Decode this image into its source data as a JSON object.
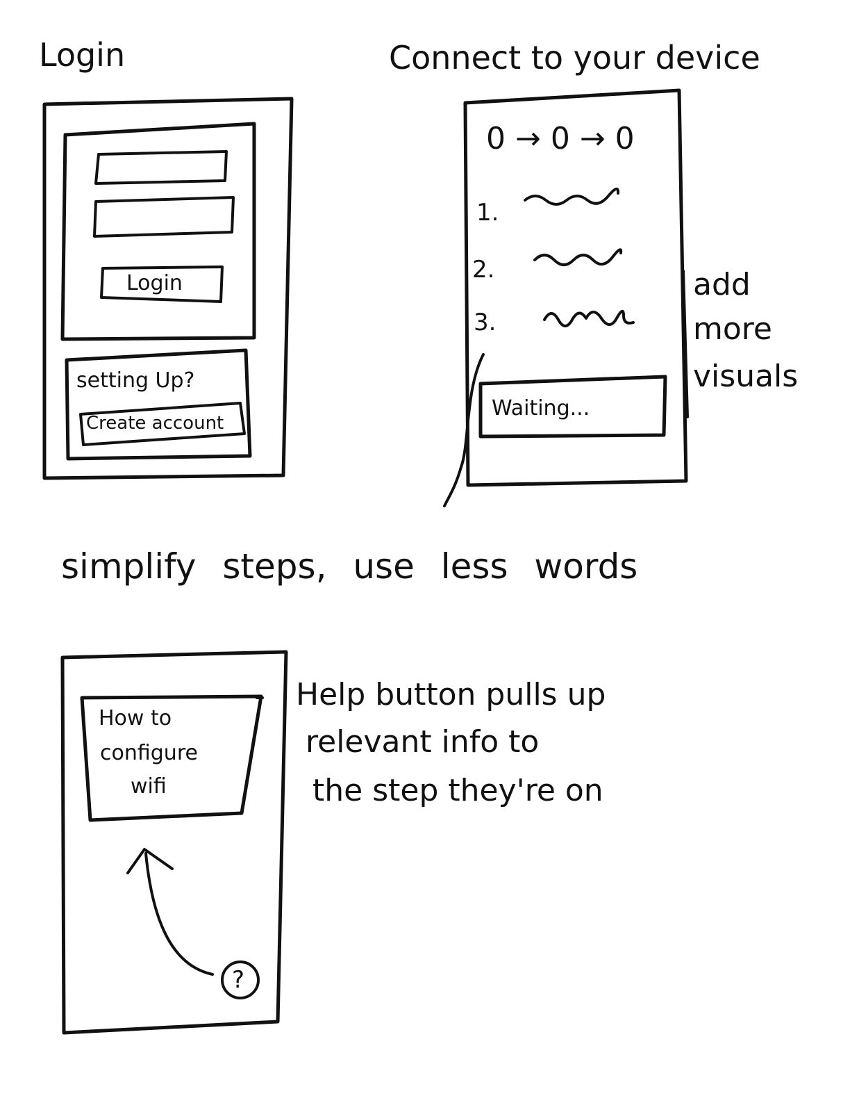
{
  "login_sketch": {
    "title": "Login",
    "login_button": "Login",
    "setup_prompt": "setting Up?",
    "create_account_button": "Create account"
  },
  "connect_sketch": {
    "title": "Connect to your device",
    "flow_glyphs": "0 → 0 → 0",
    "steps": [
      "1.",
      "2.",
      "3."
    ],
    "status": "Waiting...",
    "side_note_lines": [
      "add",
      "more",
      "visuals"
    ]
  },
  "general_note": "simplify steps, use less words",
  "help_sketch": {
    "popup_lines": [
      "How to",
      "configure",
      "wifi"
    ],
    "help_button_glyph": "?",
    "note_lines": [
      "Help button pulls up",
      "relevant info to",
      "the step they're on"
    ]
  }
}
